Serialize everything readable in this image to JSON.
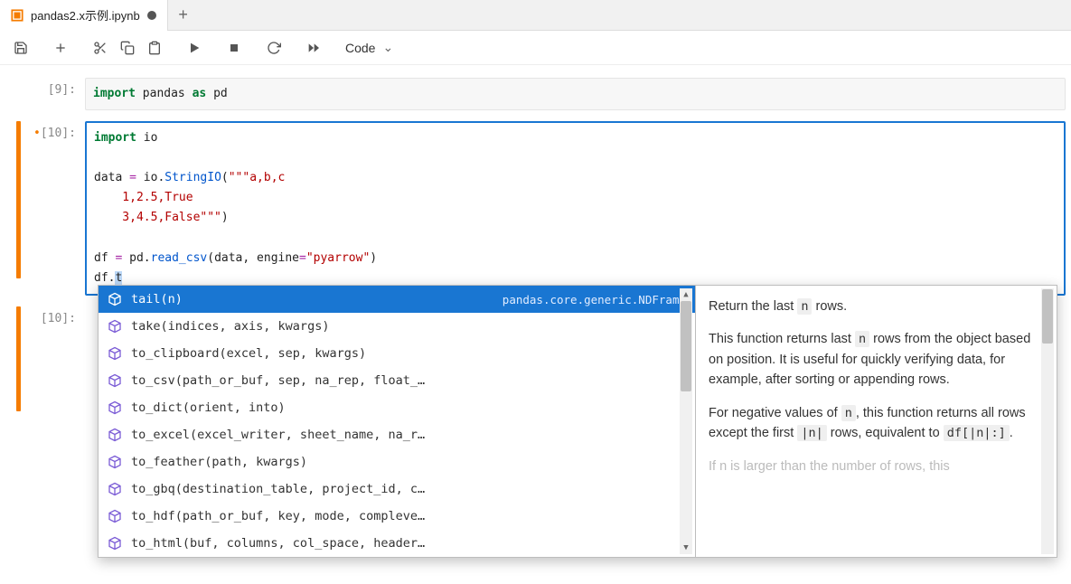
{
  "tab": {
    "title": "pandas2.x示例.ipynb",
    "modified": true
  },
  "toolbar": {
    "celltype": "Code"
  },
  "cells": [
    {
      "prompt": "[9]:",
      "active": false,
      "gutter": false
    },
    {
      "prompt": "[10]:",
      "active": true,
      "gutter": true,
      "dirty": true
    },
    {
      "prompt": "[10]:",
      "active": false,
      "gutter": true
    }
  ],
  "code9": {
    "import": "import",
    "pandas": " pandas ",
    "as": "as",
    "pd": " pd"
  },
  "code10": {
    "l1_import": "import",
    "l1_io": " io",
    "l3a": "data ",
    "l3op": "=",
    "l3b": " io.",
    "l3fn": "StringIO",
    "l3p": "(",
    "l3s": "\"\"\"a,b,c",
    "l4": "    1,2.5,True",
    "l5": "    3,4.5,False\"\"\"",
    "l5p": ")",
    "l7a": "df ",
    "l7op": "=",
    "l7b": " pd.",
    "l7fn": "read_csv",
    "l7c": "(data, engine",
    "l7op2": "=",
    "l7s": "\"pyarrow\"",
    "l7p": ")",
    "l8a": "df.",
    "l8sel": "t"
  },
  "autocomplete": {
    "items": [
      {
        "sig": "tail(n)",
        "source": "pandas.core.generic.NDFrame",
        "selected": true
      },
      {
        "sig": "take(indices, axis, kwargs)"
      },
      {
        "sig": "to_clipboard(excel, sep, kwargs)"
      },
      {
        "sig": "to_csv(path_or_buf, sep, na_rep, float_…"
      },
      {
        "sig": "to_dict(orient, into)"
      },
      {
        "sig": "to_excel(excel_writer, sheet_name, na_r…"
      },
      {
        "sig": "to_feather(path, kwargs)"
      },
      {
        "sig": "to_gbq(destination_table, project_id, c…"
      },
      {
        "sig": "to_hdf(path_or_buf, key, mode, compleve…"
      },
      {
        "sig": "to_html(buf, columns, col_space, header…"
      }
    ],
    "doc": {
      "p1a": "Return the last ",
      "p1code": "n",
      "p1b": " rows.",
      "p2a": "This function returns last ",
      "p2code": "n",
      "p2b": " rows from the object based on position. It is useful for quickly verifying data, for example, after sorting or appending rows.",
      "p3a": "For negative values of ",
      "p3code1": "n",
      "p3b": ", this function returns all rows except the first ",
      "p3code2": "|n|",
      "p3c": " rows, equivalent to ",
      "p3code3": "df[|n|:]",
      "p3d": ".",
      "p4": "If n is larger than the number of rows, this"
    }
  }
}
